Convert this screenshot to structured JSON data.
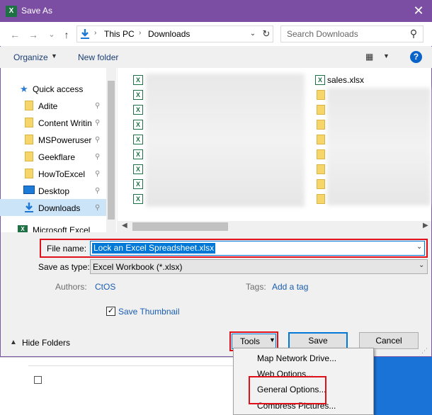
{
  "window": {
    "title": "Save As",
    "app_icon": "excel-icon",
    "close_glyph": "✕"
  },
  "nav": {
    "back_glyph": "←",
    "forward_glyph": "→",
    "recent_glyph": "⌄",
    "up_glyph": "↑",
    "address": {
      "segments": [
        "This PC",
        "Downloads"
      ],
      "separator": "›",
      "dropdown_glyph": "⌄",
      "refresh_glyph": "↻"
    },
    "search_placeholder": "Search Downloads",
    "search_glyph": "⚲"
  },
  "toolbar": {
    "organize": "Organize",
    "organize_dd": "▼",
    "new_folder": "New folder",
    "views_glyph": "▦",
    "views_dd": "▼",
    "help": "?"
  },
  "sidebar": {
    "items": [
      {
        "label": "Quick access",
        "icon": "star-icon",
        "pinned": false
      },
      {
        "label": "Adite",
        "icon": "folder-icon",
        "pinned": true
      },
      {
        "label": "Content Writin",
        "icon": "folder-icon",
        "pinned": true
      },
      {
        "label": "MSPoweruser",
        "icon": "folder-icon",
        "pinned": true
      },
      {
        "label": "Geekflare",
        "icon": "folder-icon",
        "pinned": true
      },
      {
        "label": "HowToExcel",
        "icon": "folder-icon",
        "pinned": true
      },
      {
        "label": "Desktop",
        "icon": "desktop-icon",
        "pinned": true
      },
      {
        "label": "Downloads",
        "icon": "download-icon",
        "pinned": true
      },
      {
        "label": "Microsoft Excel",
        "icon": "excel-icon",
        "pinned": false
      }
    ],
    "pin_glyph": "⚲"
  },
  "files": {
    "visible_name": "sales.xlsx",
    "xlsx_glyph": "X"
  },
  "scroll": {
    "left": "◀",
    "right": "▶"
  },
  "form": {
    "file_name_label": "File name:",
    "file_name_value": "Lock an Excel Spreadsheet.xlsx",
    "save_as_type_label": "Save as type:",
    "save_as_type_value": "Excel Workbook (*.xlsx)",
    "authors_label": "Authors:",
    "authors_value": "CtOS",
    "tags_label": "Tags:",
    "tags_value": "Add a tag",
    "save_thumbnail_label": "Save Thumbnail",
    "save_thumbnail_checked": "✓",
    "dd_glyph": "⌄"
  },
  "footer": {
    "hide_folders": "Hide Folders",
    "hide_glyph": "▲",
    "tools": "Tools",
    "tools_dd": "▼",
    "save": "Save",
    "cancel": "Cancel",
    "grip": "⋰"
  },
  "tools_menu": {
    "items": [
      "Map Network Drive...",
      "Web Options...",
      "General Options...",
      "Compress Pictures..."
    ]
  },
  "colors": {
    "titlebar": "#7b4ea3",
    "highlight_box": "#e0101a",
    "accent": "#0078d7",
    "link": "#1a5cb0"
  }
}
